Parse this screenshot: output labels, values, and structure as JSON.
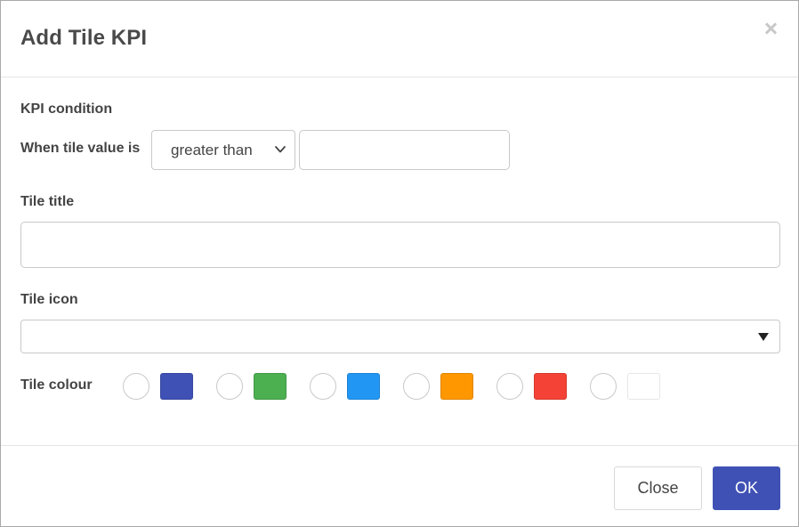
{
  "dialog": {
    "title": "Add Tile KPI",
    "close_icon": "close-icon"
  },
  "kpi": {
    "section_label": "KPI condition",
    "when_label": "When tile value is",
    "operator": "greater than",
    "value": ""
  },
  "tile_title": {
    "label": "Tile title",
    "value": ""
  },
  "tile_icon": {
    "label": "Tile icon",
    "value": ""
  },
  "tile_colour": {
    "label": "Tile colour",
    "options": [
      {
        "color": "#3f51b5"
      },
      {
        "color": "#4caf50"
      },
      {
        "color": "#2196f3"
      },
      {
        "color": "#ff9800"
      },
      {
        "color": "#f44336"
      },
      {
        "color": "#ffffff"
      }
    ]
  },
  "buttons": {
    "close": "Close",
    "ok": "OK"
  }
}
